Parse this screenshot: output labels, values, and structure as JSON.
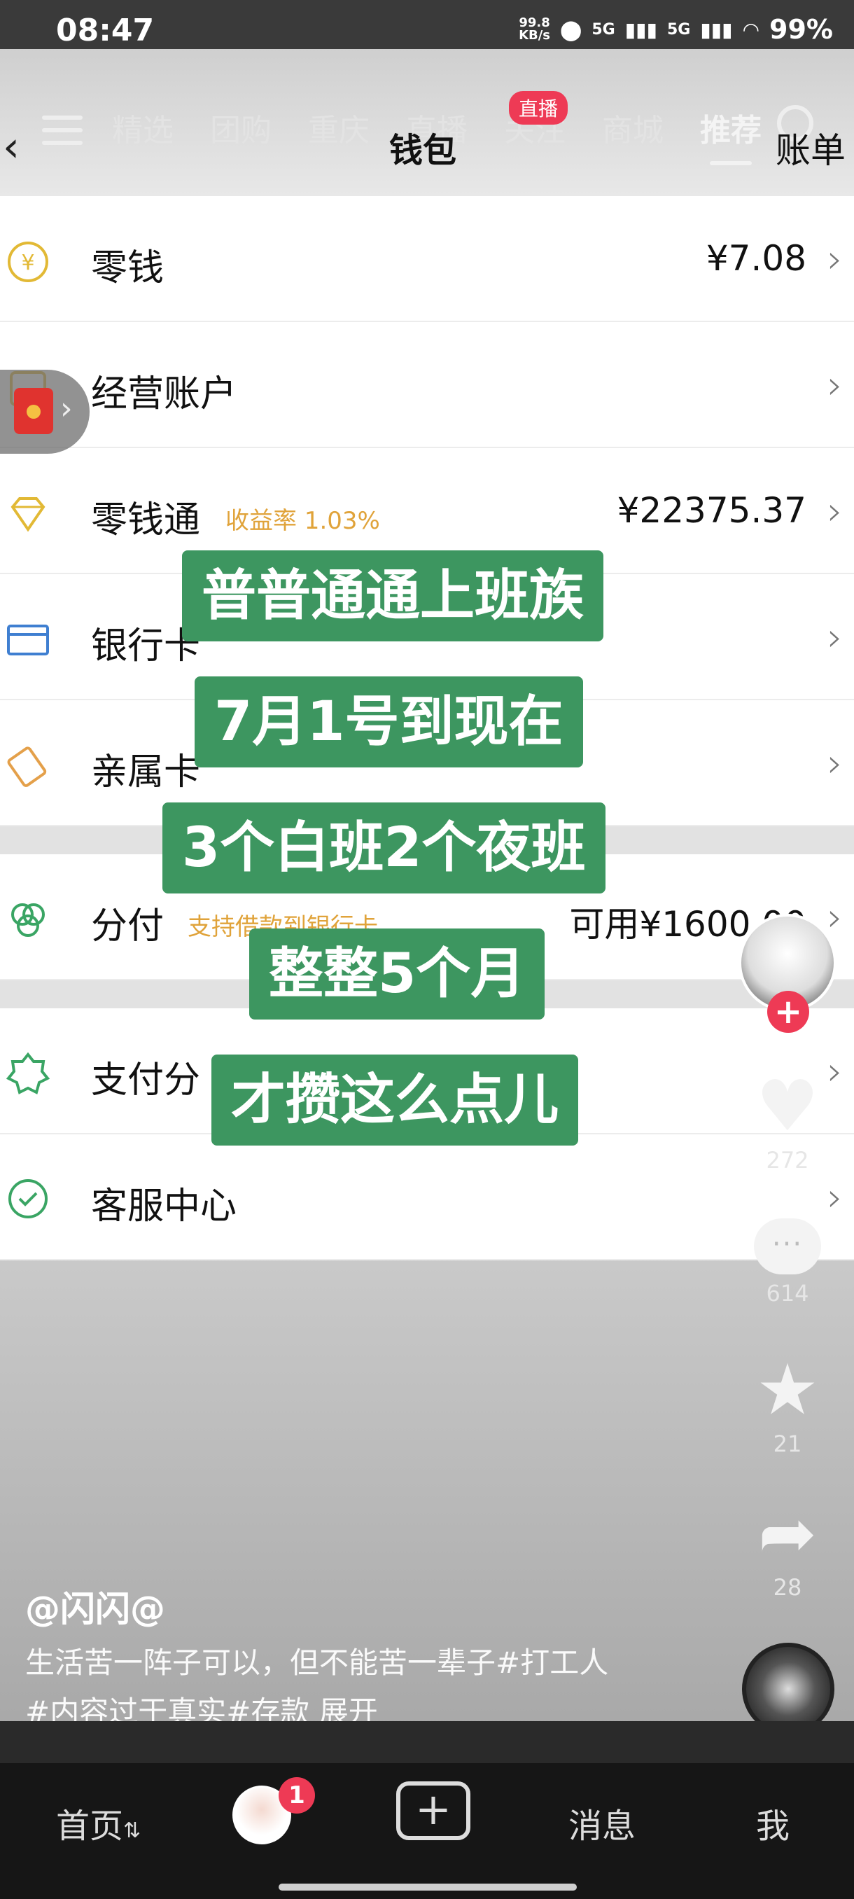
{
  "status_bar": {
    "time": "08:47",
    "net_speed_value": "99.8",
    "net_speed_unit": "KB/s",
    "signal_1": "5G",
    "signal_2": "5G",
    "battery": "99%"
  },
  "top_tabs": {
    "items": [
      "精选",
      "团购",
      "重庆",
      "直播",
      "关注",
      "商城",
      "推荐"
    ],
    "active": "推荐",
    "live_badge": "直播"
  },
  "wallet_page": {
    "title": "钱包",
    "bill_link": "账单",
    "rows": [
      {
        "label": "零钱",
        "sub": "",
        "value": "¥7.08"
      },
      {
        "label": "经营账户",
        "sub": "",
        "value": ""
      },
      {
        "label": "零钱通",
        "sub": "收益率 1.03%",
        "value": "¥22375.37"
      },
      {
        "label": "银行卡",
        "sub": "",
        "value": ""
      },
      {
        "label": "亲属卡",
        "sub": "",
        "value": ""
      }
    ],
    "rows2": [
      {
        "label": "分付",
        "sub": "支持借款到银行卡",
        "value": "可用¥1600.00"
      }
    ],
    "rows3": [
      {
        "label": "支付分",
        "sub": "",
        "value": ""
      },
      {
        "label": "客服中心",
        "sub": "",
        "value": ""
      }
    ]
  },
  "captions": [
    "普普通通上班族",
    "7月1号到现在",
    "3个白班2个夜班",
    "整整5个月",
    "才攒这么点儿"
  ],
  "right_rail": {
    "likes": "272",
    "comments": "614",
    "favorites": "21",
    "shares": "28"
  },
  "video_info": {
    "author": "@闪闪@",
    "description_line1": "生活苦一阵子可以，但不能苦一辈子#打工人",
    "description_line2": "#内容过于真实#存款 展开"
  },
  "bottom_nav": {
    "home": "首页",
    "friends_badge": "1",
    "messages": "消息",
    "me": "我"
  },
  "colors": {
    "caption_bg": "#3d9660",
    "accent_red": "#ee3a55",
    "sub_orange": "#e0a33a"
  },
  "icons": [
    "yen-icon",
    "store-icon",
    "diamond-icon",
    "card-icon",
    "family-card-icon",
    "fenfu-icon",
    "score-icon",
    "service-icon",
    "heart-icon",
    "comment-icon",
    "star-icon",
    "share-icon"
  ]
}
